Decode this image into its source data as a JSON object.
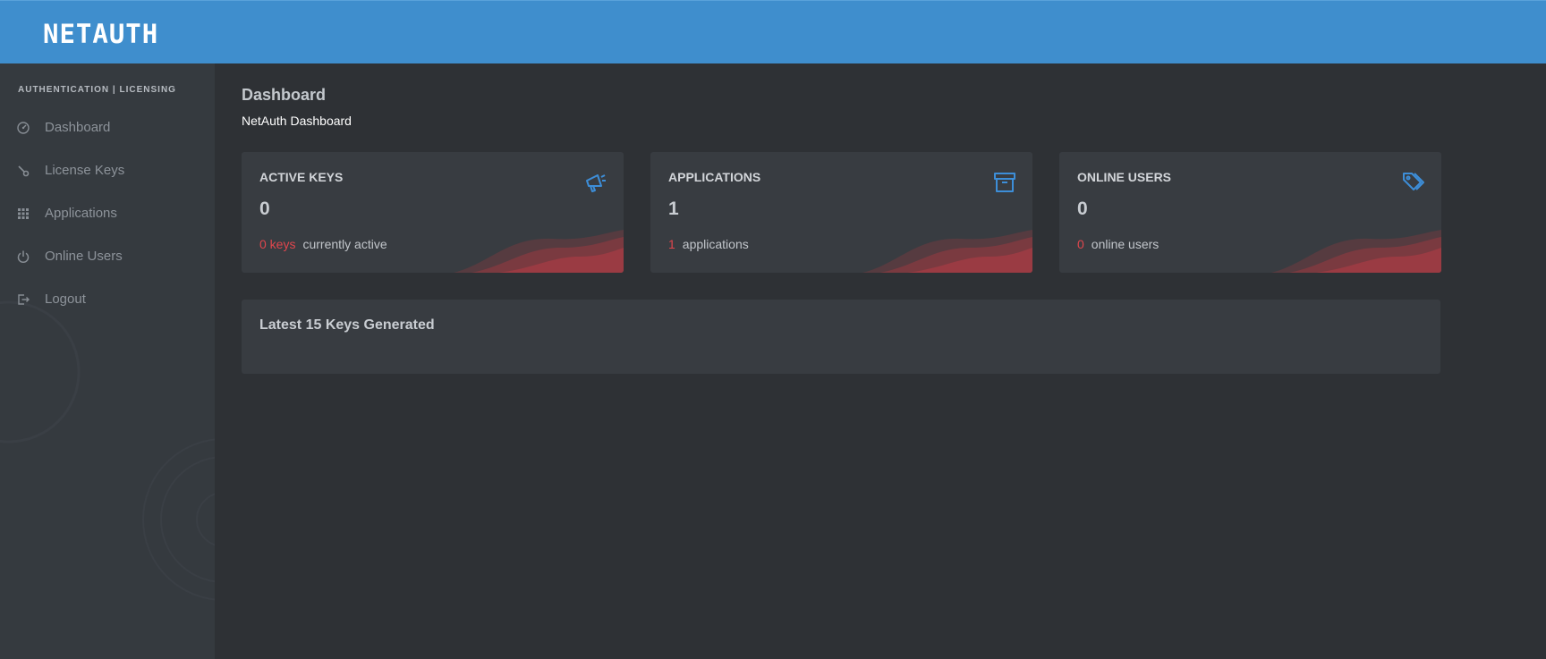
{
  "brand": {
    "logo_text": "NETAUTH"
  },
  "sidebar": {
    "heading": "AUTHENTICATION | LICENSING",
    "items": [
      {
        "label": "Dashboard",
        "icon": "dashboard-icon"
      },
      {
        "label": "License Keys",
        "icon": "key-icon"
      },
      {
        "label": "Applications",
        "icon": "grid-icon"
      },
      {
        "label": "Online Users",
        "icon": "power-icon"
      },
      {
        "label": "Logout",
        "icon": "logout-icon"
      }
    ]
  },
  "page": {
    "title": "Dashboard",
    "subtitle": "NetAuth Dashboard"
  },
  "cards": [
    {
      "title": "ACTIVE KEYS",
      "value": "0",
      "highlight": "0 keys",
      "text": "currently active",
      "icon": "megaphone-icon"
    },
    {
      "title": "APPLICATIONS",
      "value": "1",
      "highlight": "1",
      "text": "applications",
      "icon": "archive-icon"
    },
    {
      "title": "ONLINE USERS",
      "value": "0",
      "highlight": "0",
      "text": "online users",
      "icon": "tags-icon"
    }
  ],
  "panel": {
    "title": "Latest 15 Keys Generated"
  },
  "colors": {
    "topbar": "#3f8ecd",
    "sidebar": "#353a3f",
    "background": "#2e3135",
    "card": "#383c41",
    "accent_red": "#e0464d",
    "icon_blue": "#3d8ed8"
  }
}
